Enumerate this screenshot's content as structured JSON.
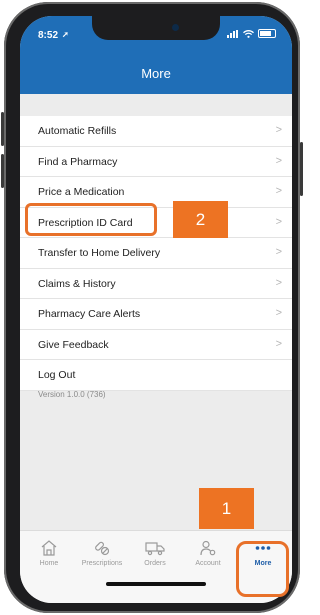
{
  "status": {
    "time": "8:52"
  },
  "header": {
    "title": "More"
  },
  "menu": {
    "items": [
      {
        "label": "Automatic Refills"
      },
      {
        "label": "Find a Pharmacy"
      },
      {
        "label": "Price a Medication"
      },
      {
        "label": "Prescription ID Card"
      },
      {
        "label": "Transfer to Home Delivery"
      },
      {
        "label": "Claims & History"
      },
      {
        "label": "Pharmacy Care Alerts"
      },
      {
        "label": "Give Feedback"
      },
      {
        "label": "Log Out"
      }
    ],
    "chevron": ">"
  },
  "version": "Version 1.0.0 (736)",
  "tabs": [
    {
      "label": "Home",
      "icon": "home-icon"
    },
    {
      "label": "Prescriptions",
      "icon": "pills-icon"
    },
    {
      "label": "Orders",
      "icon": "truck-icon"
    },
    {
      "label": "Account",
      "icon": "account-icon"
    },
    {
      "label": "More",
      "icon": "more-dots-icon",
      "active": true
    }
  ],
  "callouts": [
    {
      "number": "2"
    },
    {
      "number": "1"
    }
  ],
  "colors": {
    "header": "#1f6eb7",
    "accent": "#ed7323",
    "active_tab": "#1f5ea8"
  }
}
